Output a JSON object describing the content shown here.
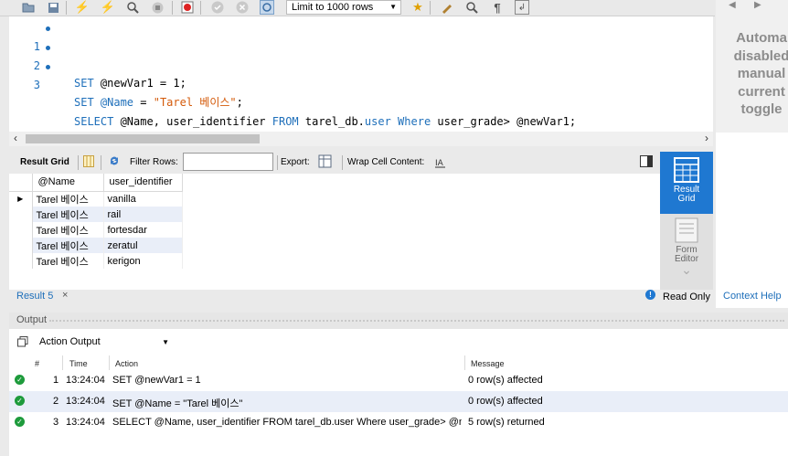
{
  "toolbar": {
    "icons": [
      "folder-icon",
      "save-icon",
      "execute-icon",
      "execute-current-icon",
      "explain-icon",
      "stop-icon",
      "toggle-error-icon",
      "commit-icon",
      "rollback-icon",
      "autocommit-icon",
      "bookmark-icon",
      "beautify-icon",
      "find-icon",
      "invisible-chars-icon",
      "wrap-icon"
    ],
    "limit_label": "Limit to 1000 rows"
  },
  "editor": {
    "lines": [
      {
        "n": "1"
      },
      {
        "n": "2"
      },
      {
        "n": "3"
      }
    ],
    "line1": {
      "kw1": "SET",
      "rest": " @newVar1 = 1;"
    },
    "line2": {
      "kw1": "SET",
      "var": " @Name",
      "eq": " = ",
      "str": "\"Tarel 베이스\"",
      "semi": ";"
    },
    "line3": {
      "kw1": "SELECT",
      "a": " @Name, user_identifier ",
      "kw2": "FROM",
      "b": " tarel_db.",
      "kw3": "user",
      "c": " ",
      "kw4": "Where",
      "d": " user_grade> @newVar1;"
    }
  },
  "side_panel": {
    "nav_left": "◀",
    "nav_right": "▶",
    "lines": [
      "Automa",
      "disabled",
      "manual",
      "current",
      "toggle"
    ]
  },
  "result_toolbar": {
    "result_grid": "Result Grid",
    "filter_rows": "Filter Rows:",
    "export": "Export:",
    "wrap_cell": "Wrap Cell Content:"
  },
  "result_grid": {
    "columns": [
      "@Name",
      "user_identifier"
    ],
    "rows": [
      [
        "Tarel 베이스",
        "vanilla"
      ],
      [
        "Tarel 베이스",
        "rail"
      ],
      [
        "Tarel 베이스",
        "fortesdar"
      ],
      [
        "Tarel 베이스",
        "zeratul"
      ],
      [
        "Tarel 베이스",
        "kerigon"
      ]
    ]
  },
  "side_buttons": {
    "result_grid": "Result Grid",
    "form_editor": "Form Editor"
  },
  "tabs": {
    "result_tab": "Result 5",
    "close": "×",
    "read_only": "Read Only",
    "context_help": "Context Help"
  },
  "output": {
    "header": "Output",
    "selector": "Action Output",
    "columns": {
      "num": "#",
      "time": "Time",
      "action": "Action",
      "message": "Message"
    },
    "rows": [
      {
        "num": "1",
        "time": "13:24:04",
        "action": "SET @newVar1 = 1",
        "message": "0 row(s) affected"
      },
      {
        "num": "2",
        "time": "13:24:04",
        "action": "SET @Name = \"Tarel 베이스\"",
        "message": "0 row(s) affected"
      },
      {
        "num": "3",
        "time": "13:24:04",
        "action": "SELECT @Name, user_identifier FROM tarel_db.user Where user_grade> @n...",
        "message": "5 row(s) returned"
      }
    ]
  },
  "colors": {
    "accent": "#1f78d1",
    "keyword": "#1e6fba",
    "string": "#d45a0a",
    "ok": "#1e9b3c"
  }
}
